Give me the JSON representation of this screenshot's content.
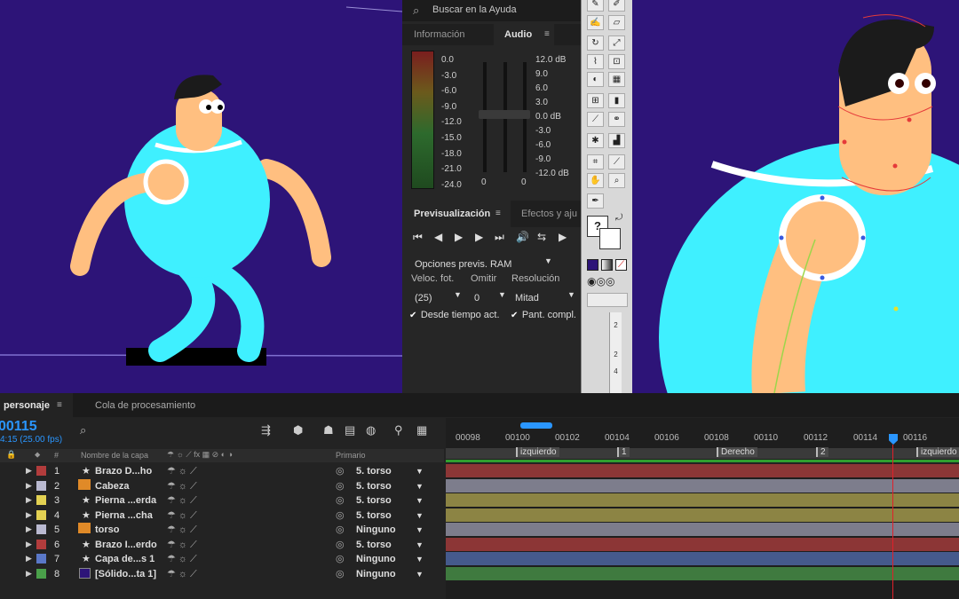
{
  "help": {
    "search_placeholder": "Buscar en la Ayuda"
  },
  "info_panel": {
    "tab_info": "Información",
    "tab_audio": "Audio"
  },
  "audio": {
    "left_scale": [
      "0.0",
      "-3.0",
      "-6.0",
      "-9.0",
      "-12.0",
      "-15.0",
      "-18.0",
      "-21.0",
      "-24.0"
    ],
    "right_scale": [
      "12.0 dB",
      "9.0",
      "6.0",
      "3.0",
      "0.0 dB",
      "-3.0",
      "-6.0",
      "-9.0",
      "-12.0 dB"
    ],
    "slider_zero_left": "0",
    "slider_zero_right": "0"
  },
  "preview_panel": {
    "tab_preview": "Previsualización",
    "tab_effects": "Efectos y aju",
    "ram_options": "Opciones previs. RAM",
    "frame_rate_label": "Veloc. fot.",
    "skip_label": "Omitir",
    "resolution_label": "Resolución",
    "frame_rate_value": "(25)",
    "skip_value": "0",
    "resolution_value": "Mitad",
    "from_current_time": "Desde tiempo act.",
    "full_screen": "Pant. compl."
  },
  "timeline": {
    "comp_tab": "personaje",
    "render_queue_tab": "Cola de procesamiento",
    "current_time": "00115",
    "fps_info": "4:15 (25.00 fps)",
    "search_placeholder": "",
    "col_layer_name": "Nombre de la capa",
    "col_parent": "Primario",
    "col_hash": "#",
    "ruler": [
      "00098",
      "00100",
      "00102",
      "00104",
      "00106",
      "00108",
      "00110",
      "00112",
      "00114",
      "00116"
    ],
    "markers": [
      "izquierdo",
      "1",
      "Derecho",
      "2",
      "izquierdo"
    ],
    "layers": [
      {
        "num": "1",
        "name": "Brazo D...ho",
        "parent": "5. torso",
        "color": "#b23c3c",
        "bar": "#8c3636"
      },
      {
        "num": "2",
        "name": "Cabeza",
        "parent": "5. torso",
        "color": "#b9b9d0",
        "bar": "#7d7d8c"
      },
      {
        "num": "3",
        "name": "Pierna ...erda",
        "parent": "5. torso",
        "color": "#e3d152",
        "bar": "#8c8444"
      },
      {
        "num": "4",
        "name": "Pierna ...cha",
        "parent": "5. torso",
        "color": "#e3d152",
        "bar": "#8c8444"
      },
      {
        "num": "5",
        "name": "torso",
        "parent": "Ninguno",
        "color": "#b9b9d0",
        "bar": "#7d7d8c"
      },
      {
        "num": "6",
        "name": "Brazo I...erdo",
        "parent": "5. torso",
        "color": "#b23c3c",
        "bar": "#8c3636"
      },
      {
        "num": "7",
        "name": "Capa de...s 1",
        "parent": "Ninguno",
        "color": "#5a78c8",
        "bar": "#455a8c"
      },
      {
        "num": "8",
        "name": "[Sólido...ta 1]",
        "parent": "Ninguno",
        "color": "#4aa04a",
        "bar": "#3f7a3f"
      }
    ]
  },
  "colors": {
    "viewer_bg": "#2d1478",
    "character_blue": "#3ff0ff",
    "skin": "#ffbf80",
    "accent_blue": "#2a96ff",
    "playhead": "#e0202a"
  }
}
